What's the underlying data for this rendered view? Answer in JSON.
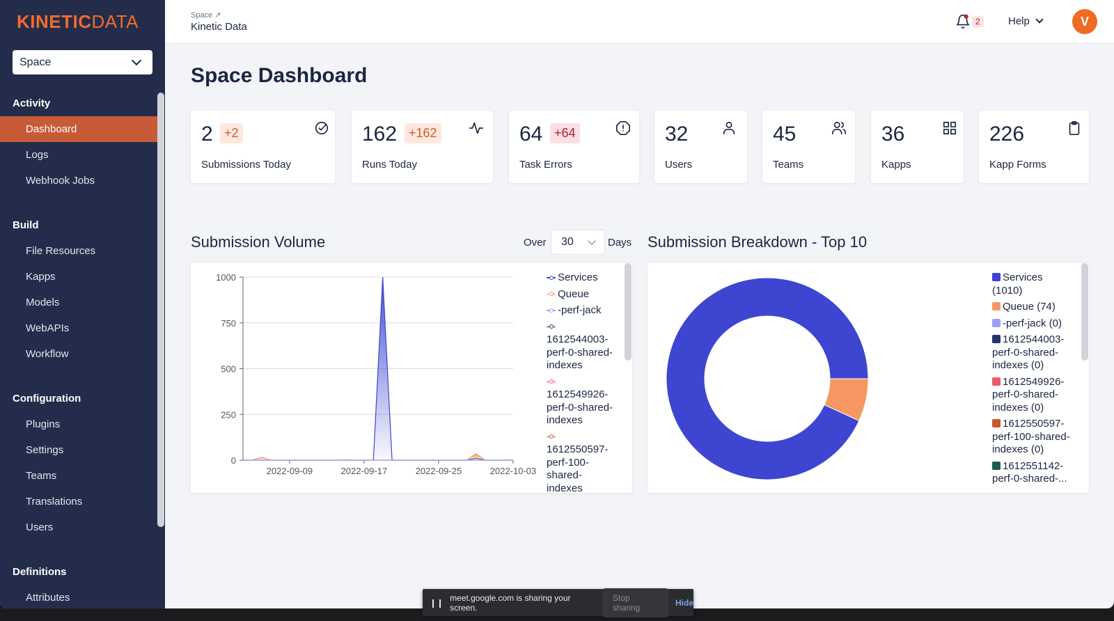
{
  "app": {
    "logo_bold": "KINETIC",
    "logo_light": "DATA",
    "space_select": "Space"
  },
  "topbar": {
    "breadcrumb_parent": "Space ↗",
    "breadcrumb_title": "Kinetic Data",
    "notification_count": "2",
    "help_label": "Help",
    "avatar_initial": "V"
  },
  "sidebar": {
    "sections": [
      {
        "title": "Activity",
        "items": [
          "Dashboard",
          "Logs",
          "Webhook Jobs"
        ]
      },
      {
        "title": "Build",
        "items": [
          "File Resources",
          "Kapps",
          "Models",
          "WebAPIs",
          "Workflow"
        ]
      },
      {
        "title": "Configuration",
        "items": [
          "Plugins",
          "Settings",
          "Teams",
          "Translations",
          "Users"
        ]
      },
      {
        "title": "Definitions",
        "items": [
          "Attributes"
        ]
      }
    ],
    "active_item": "Dashboard"
  },
  "page": {
    "title": "Space Dashboard"
  },
  "stats": [
    {
      "value": "2",
      "delta": "+2",
      "label": "Submissions Today",
      "icon": "check-circle-icon"
    },
    {
      "value": "162",
      "delta": "+162",
      "label": "Runs Today",
      "icon": "activity-icon"
    },
    {
      "value": "64",
      "delta": "+64",
      "label": "Task Errors",
      "icon": "alert-octagon-icon"
    },
    {
      "value": "32",
      "delta": "",
      "label": "Users",
      "icon": "user-icon"
    },
    {
      "value": "45",
      "delta": "",
      "label": "Teams",
      "icon": "users-icon"
    },
    {
      "value": "36",
      "delta": "",
      "label": "Kapps",
      "icon": "grid-icon"
    },
    {
      "value": "226",
      "delta": "",
      "label": "Kapp Forms",
      "icon": "clipboard-icon"
    }
  ],
  "volume": {
    "title": "Submission Volume",
    "over_label": "Over",
    "days_value": "30",
    "days_label": "Days"
  },
  "breakdown": {
    "title": "Submission Breakdown - Top 10"
  },
  "chart_data": [
    {
      "type": "area",
      "title": "Submission Volume",
      "xlabel": "",
      "ylabel": "",
      "ylim": [
        0,
        1000
      ],
      "yticks": [
        0,
        250,
        500,
        750,
        1000
      ],
      "xticks": [
        "2022-09-09",
        "2022-09-17",
        "2022-09-25",
        "2022-10-03"
      ],
      "x": [
        "2022-09-04",
        "2022-09-05",
        "2022-09-06",
        "2022-09-07",
        "2022-09-08",
        "2022-09-09",
        "2022-09-10",
        "2022-09-11",
        "2022-09-12",
        "2022-09-13",
        "2022-09-14",
        "2022-09-15",
        "2022-09-16",
        "2022-09-17",
        "2022-09-18",
        "2022-09-19",
        "2022-09-20",
        "2022-09-21",
        "2022-09-22",
        "2022-09-23",
        "2022-09-24",
        "2022-09-25",
        "2022-09-26",
        "2022-09-27",
        "2022-09-28",
        "2022-09-29",
        "2022-09-30",
        "2022-10-01",
        "2022-10-02",
        "2022-10-03"
      ],
      "series": [
        {
          "name": "Services",
          "color": "#3d45d1",
          "values": [
            0,
            0,
            0,
            0,
            0,
            0,
            0,
            0,
            0,
            0,
            0,
            0,
            0,
            0,
            0,
            1000,
            0,
            0,
            0,
            0,
            0,
            0,
            0,
            0,
            0,
            10,
            0,
            0,
            0,
            0
          ]
        },
        {
          "name": "Queue",
          "color": "#f58f5a",
          "values": [
            0,
            0,
            15,
            0,
            0,
            0,
            0,
            0,
            0,
            0,
            0,
            2,
            0,
            0,
            0,
            0,
            0,
            0,
            0,
            0,
            0,
            0,
            0,
            0,
            0,
            35,
            0,
            0,
            0,
            2
          ]
        },
        {
          "name": "-perf-jack",
          "color": "#9ba0f5",
          "values": [
            0,
            0,
            0,
            0,
            0,
            0,
            0,
            0,
            0,
            0,
            0,
            0,
            0,
            0,
            0,
            0,
            0,
            0,
            0,
            0,
            0,
            0,
            0,
            0,
            0,
            0,
            0,
            0,
            0,
            0
          ]
        },
        {
          "name": "1612544003-perf-0-shared-indexes",
          "color": "#26336e",
          "values": []
        },
        {
          "name": "1612549926-perf-0-shared-indexes",
          "color": "#ef5a6a",
          "values": []
        },
        {
          "name": "1612550597-perf-100-shared-indexes",
          "color": "#c8552f",
          "values": []
        }
      ],
      "legend_position": "right",
      "grid": true
    },
    {
      "type": "pie",
      "title": "Submission Breakdown - Top 10",
      "donut": true,
      "slices": [
        {
          "label": "Services",
          "value": 1010,
          "color": "#3d45d1"
        },
        {
          "label": "Queue",
          "value": 74,
          "color": "#f79660"
        },
        {
          "label": "-perf-jack",
          "value": 0,
          "color": "#9ba0f5"
        },
        {
          "label": "1612544003-perf-0-shared-indexes",
          "value": 0,
          "color": "#26336e"
        },
        {
          "label": "1612549926-perf-0-shared-indexes",
          "value": 0,
          "color": "#ef5a6a"
        },
        {
          "label": "1612550597-perf-100-shared-indexes",
          "value": 0,
          "color": "#c8552f"
        },
        {
          "label": "1612551142-perf-0-shared-indexes",
          "value": 0,
          "color": "#1f5c4e"
        }
      ],
      "legend_labels": [
        "Services (1010)",
        "Queue (74)",
        "-perf-jack (0)",
        "1612544003-perf-0-shared-indexes (0)",
        "1612549926-perf-0-shared-indexes (0)",
        "1612550597-perf-100-shared-indexes (0)",
        "1612551142-perf-0-shared-..."
      ],
      "legend_position": "right"
    }
  ],
  "share_bar": {
    "message": "meet.google.com is sharing your screen.",
    "stop_label": "Stop sharing",
    "hide_label": "Hide"
  }
}
